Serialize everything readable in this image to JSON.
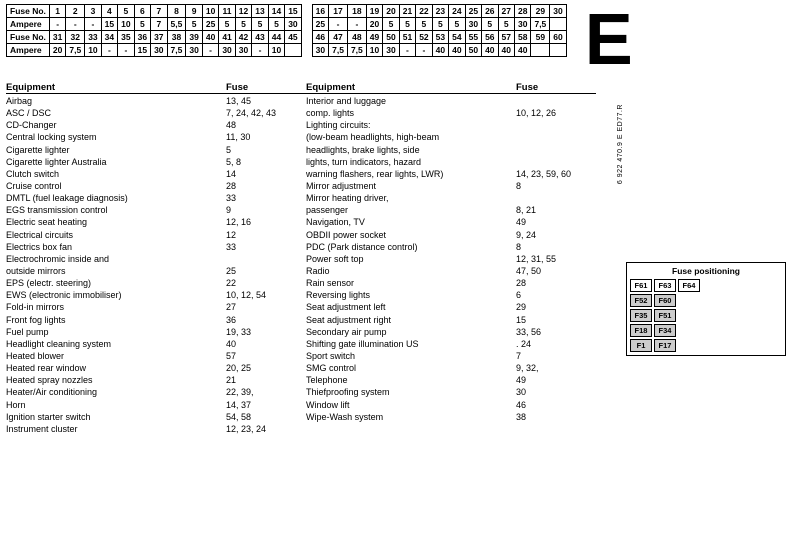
{
  "tables": {
    "left": {
      "rows": [
        {
          "label": "Fuse No.",
          "values": [
            "1",
            "2",
            "3",
            "4",
            "5",
            "6",
            "7",
            "8",
            "9",
            "10",
            "11",
            "12",
            "13",
            "14",
            "15"
          ]
        },
        {
          "label": "Ampere",
          "values": [
            "-",
            "-",
            "-",
            "15",
            "10",
            "5",
            "7",
            "5,5",
            "5",
            "25",
            "5",
            "5",
            "5",
            "5",
            "30"
          ]
        },
        {
          "label": "Fuse No.",
          "values": [
            "31",
            "32",
            "33",
            "34",
            "35",
            "36",
            "37",
            "38",
            "39",
            "40",
            "41",
            "42",
            "43",
            "44",
            "45"
          ]
        },
        {
          "label": "Ampere",
          "values": [
            "20",
            "7,5",
            "10",
            "-",
            "-",
            "15",
            "30",
            "7,5",
            "30",
            "-",
            "30",
            "30",
            "-",
            "10",
            ""
          ]
        }
      ]
    },
    "right": {
      "rows": [
        {
          "label": "",
          "values": [
            "16",
            "17",
            "18",
            "19",
            "20",
            "21",
            "22",
            "23",
            "24",
            "25",
            "26",
            "27",
            "28",
            "29",
            "30"
          ]
        },
        {
          "label": "",
          "values": [
            "25",
            "-",
            "-",
            "20",
            "5",
            "5",
            "5",
            "5",
            "5",
            "30",
            "5",
            "5",
            "30",
            "7,5",
            ""
          ]
        },
        {
          "label": "",
          "values": [
            "46",
            "47",
            "48",
            "49",
            "50",
            "51",
            "52",
            "53",
            "54",
            "55",
            "56",
            "57",
            "58",
            "59",
            "60"
          ]
        },
        {
          "label": "",
          "values": [
            "30",
            "7,5",
            "7,5",
            "10",
            "30",
            "-",
            "-",
            "40",
            "40",
            "50",
            "40",
            "40",
            "40",
            "",
            ""
          ]
        }
      ]
    }
  },
  "equipment_left": {
    "header": {
      "equipment": "Equipment",
      "fuse": "Fuse"
    },
    "items": [
      {
        "name": "Airbag",
        "fuse": "13, 45"
      },
      {
        "name": "ASC / DSC",
        "fuse": "7, 24, 42, 43"
      },
      {
        "name": "CD-Changer",
        "fuse": "48"
      },
      {
        "name": "Central locking system",
        "fuse": "11, 30"
      },
      {
        "name": "Cigarette lighter",
        "fuse": "5"
      },
      {
        "name": "Cigarette lighter Australia",
        "fuse": "5, 8"
      },
      {
        "name": "Clutch switch",
        "fuse": "14"
      },
      {
        "name": "Cruise control",
        "fuse": "28"
      },
      {
        "name": "DMTL (fuel leakage diagnosis)",
        "fuse": "33"
      },
      {
        "name": "EGS transmission control",
        "fuse": "9"
      },
      {
        "name": "Electric seat heating",
        "fuse": "12, 16"
      },
      {
        "name": "Electrical circuits",
        "fuse": "12"
      },
      {
        "name": "Electrics box fan",
        "fuse": "33"
      },
      {
        "name": "Electrochromic inside and",
        "fuse": ""
      },
      {
        "name": "outside mirrors",
        "fuse": "25"
      },
      {
        "name": "EPS (electr. steering)",
        "fuse": "22"
      },
      {
        "name": "EWS (electronic immobiliser)",
        "fuse": "10, 12, 54"
      },
      {
        "name": "Fold-in mirrors",
        "fuse": "27"
      },
      {
        "name": "Front fog lights",
        "fuse": "36"
      },
      {
        "name": "Fuel pump",
        "fuse": "19, 33"
      },
      {
        "name": "Headlight cleaning system",
        "fuse": "40"
      },
      {
        "name": "Heated blower",
        "fuse": "57"
      },
      {
        "name": "Heated rear window",
        "fuse": "20, 25"
      },
      {
        "name": "Heated spray nozzles",
        "fuse": "21"
      },
      {
        "name": "Heater/Air conditioning",
        "fuse": "22, 39,"
      },
      {
        "name": "Horn",
        "fuse": "14, 37"
      },
      {
        "name": "Ignition starter switch",
        "fuse": "54, 58"
      },
      {
        "name": "Instrument cluster",
        "fuse": "12, 23, 24"
      }
    ]
  },
  "equipment_right": {
    "header": {
      "equipment": "Equipment",
      "fuse": "Fuse"
    },
    "items": [
      {
        "name": "Interior and luggage",
        "fuse": ""
      },
      {
        "name": "comp. lights",
        "fuse": "10, 12, 26"
      },
      {
        "name": "Lighting circuits:",
        "fuse": ""
      },
      {
        "name": "(low-beam headlights, high-beam",
        "fuse": ""
      },
      {
        "name": "headlights, brake lights, side",
        "fuse": ""
      },
      {
        "name": "lights, turn indicators, hazard",
        "fuse": ""
      },
      {
        "name": "warning flashers, rear lights, LWR)",
        "fuse": "14, 23, 59, 60"
      },
      {
        "name": "Mirror adjustment",
        "fuse": "8"
      },
      {
        "name": "Mirror heating driver,",
        "fuse": ""
      },
      {
        "name": "passenger",
        "fuse": "8, 21"
      },
      {
        "name": "Navigation, TV",
        "fuse": "49"
      },
      {
        "name": "OBDII power socket",
        "fuse": "9, 24"
      },
      {
        "name": "PDC (Park distance control)",
        "fuse": "8"
      },
      {
        "name": "Power soft top",
        "fuse": "12, 31, 55"
      },
      {
        "name": "Radio",
        "fuse": "47, 50"
      },
      {
        "name": "Rain sensor",
        "fuse": "28"
      },
      {
        "name": "Reversing lights",
        "fuse": "6"
      },
      {
        "name": "Seat adjustment left",
        "fuse": "29"
      },
      {
        "name": "Seat adjustment right",
        "fuse": "15"
      },
      {
        "name": "Secondary air pump",
        "fuse": "33, 56"
      },
      {
        "name": "Shifting gate illumination US",
        "fuse": ". 24"
      },
      {
        "name": "Sport switch",
        "fuse": "7"
      },
      {
        "name": "SMG control",
        "fuse": "9, 32,"
      },
      {
        "name": "Telephone",
        "fuse": "49"
      },
      {
        "name": "Thiefproofing system",
        "fuse": "30"
      },
      {
        "name": "Window lift",
        "fuse": "46"
      },
      {
        "name": "Wipe-Wash system",
        "fuse": "38"
      }
    ]
  },
  "big_e": "E",
  "side_code": "6 922 470.9 E ED77.R",
  "fuse_diagram": {
    "title": "Fuse positioning",
    "rows": [
      [
        "F61",
        "F63",
        "F64"
      ],
      [
        "F52",
        "F60",
        ""
      ],
      [
        "F35",
        "F51",
        ""
      ],
      [
        "F18",
        "F34",
        ""
      ],
      [
        "F1",
        "F17",
        ""
      ]
    ]
  }
}
